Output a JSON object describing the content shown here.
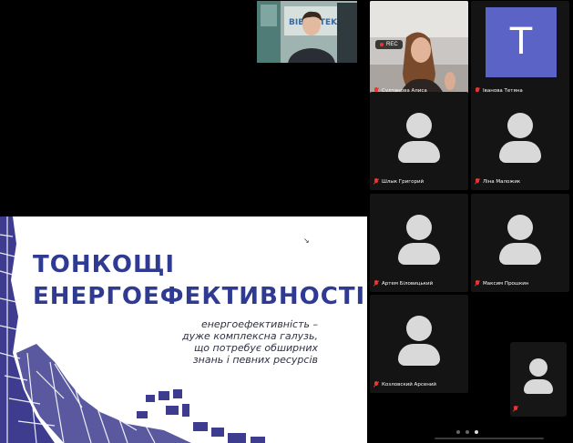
{
  "slide": {
    "title_line1": "ТОНКОЩІ",
    "title_line2": "ЕНЕРГОЕФЕКТИВНОСТІ",
    "subtitle_lines": [
      "енергоефективність –",
      "дуже комплексна галузь,",
      "що потребує обширних",
      "знань і певних ресурсів"
    ],
    "cursor": "↘"
  },
  "speaker_banner": "BIBLIOTEKA",
  "recording": {
    "label": "REC"
  },
  "participants": [
    {
      "name": "Султанова Алиса",
      "muted": true,
      "video": true
    },
    {
      "name": "Іванова Тетяна",
      "muted": true,
      "initial": "T",
      "color": "#5b64c6"
    },
    {
      "name": "Шлык Григорий",
      "muted": true
    },
    {
      "name": "Ліна Маложик",
      "muted": true
    },
    {
      "name": "Артем Біловицький",
      "muted": true
    },
    {
      "name": "Максим Прошкин",
      "muted": true
    },
    {
      "name": "Козловский Арсений",
      "muted": true
    }
  ],
  "pages": {
    "current": 3,
    "total": 3
  }
}
